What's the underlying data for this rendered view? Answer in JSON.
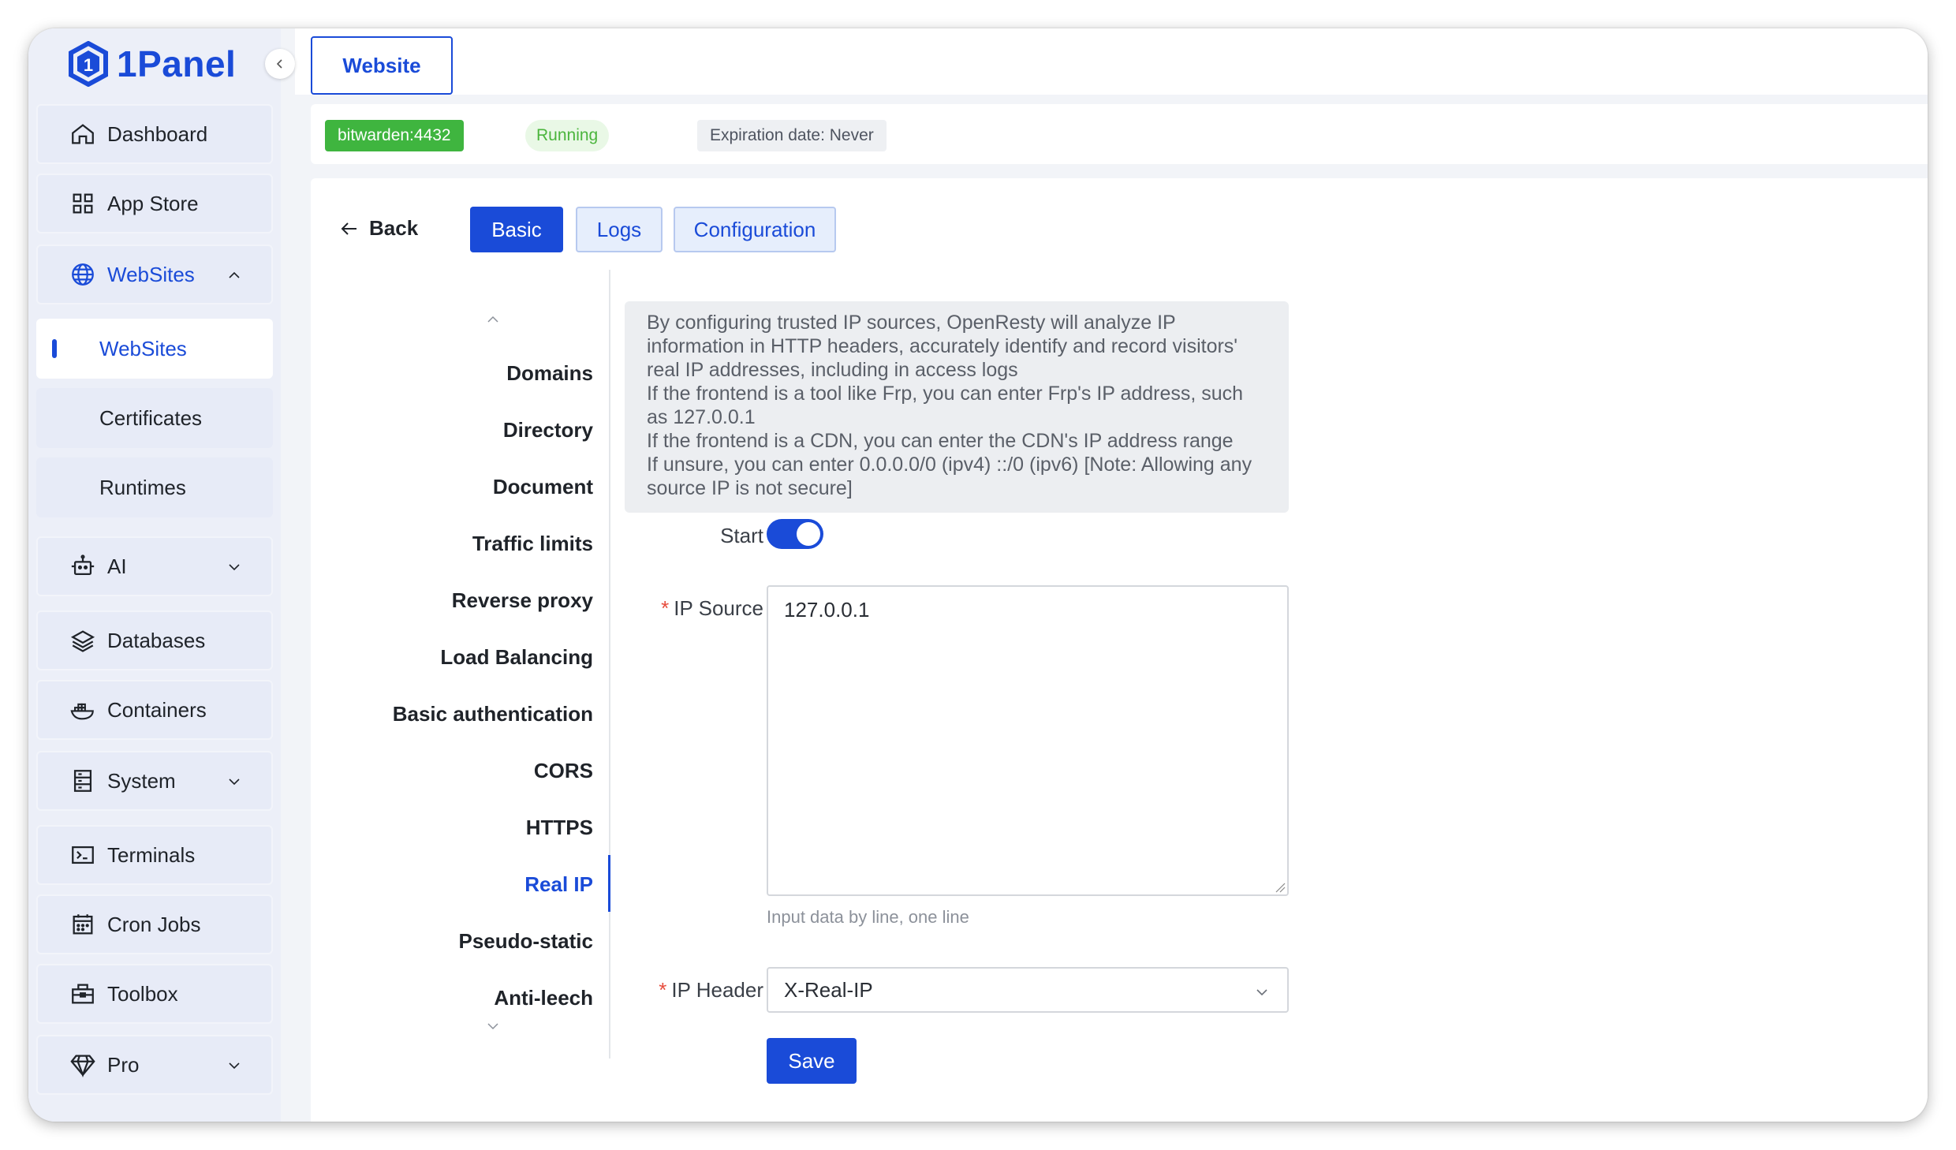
{
  "app": {
    "name": "1Panel"
  },
  "sidebar": {
    "items": [
      {
        "label": "Dashboard",
        "icon": "home-icon"
      },
      {
        "label": "App Store",
        "icon": "grid-icon"
      },
      {
        "label": "WebSites",
        "icon": "globe-icon",
        "expanded": true
      },
      {
        "label": "AI",
        "icon": "robot-icon"
      },
      {
        "label": "Databases",
        "icon": "layers-icon"
      },
      {
        "label": "Containers",
        "icon": "docker-icon"
      },
      {
        "label": "System",
        "icon": "server-icon"
      },
      {
        "label": "Terminals",
        "icon": "terminal-icon"
      },
      {
        "label": "Cron Jobs",
        "icon": "calendar-icon"
      },
      {
        "label": "Toolbox",
        "icon": "toolbox-icon"
      },
      {
        "label": "Pro",
        "icon": "diamond-icon"
      }
    ],
    "subitems": [
      {
        "label": "WebSites",
        "active": true
      },
      {
        "label": "Certificates"
      },
      {
        "label": "Runtimes"
      }
    ]
  },
  "header": {
    "tab": "Website"
  },
  "info": {
    "site": "bitwarden:4432",
    "status": "Running",
    "expiration": "Expiration date: Never"
  },
  "toolbar": {
    "back": "Back",
    "tabs": [
      "Basic",
      "Logs",
      "Configuration"
    ],
    "active_tab": "Basic"
  },
  "menu": {
    "items": [
      "Domains",
      "Directory",
      "Document",
      "Traffic limits",
      "Reverse proxy",
      "Load Balancing",
      "Basic authentication",
      "CORS",
      "HTTPS",
      "Real IP",
      "Pseudo-static",
      "Anti-leech"
    ],
    "active": "Real IP"
  },
  "form": {
    "tip": [
      "By configuring trusted IP sources, OpenResty will analyze IP",
      "information in HTTP headers, accurately identify and record visitors'",
      "real IP addresses, including in access logs",
      "If the frontend is a tool like Frp, you can enter Frp's IP address, such",
      "as 127.0.0.1",
      "If the frontend is a CDN, you can enter the CDN's IP address range",
      "If unsure, you can enter 0.0.0.0/0 (ipv4) ::/0 (ipv6) [Note: Allowing any",
      "source IP is not secure]"
    ],
    "start_label": "Start",
    "start_enabled": true,
    "ip_source_label": "IP Source",
    "ip_source_value": "127.0.0.1",
    "ip_source_hint": "Input data by line, one line",
    "ip_header_label": "IP Header",
    "ip_header_value": "X-Real-IP",
    "save_label": "Save"
  },
  "colors": {
    "accent": "#1a4bd8",
    "success": "#3fb53f"
  }
}
